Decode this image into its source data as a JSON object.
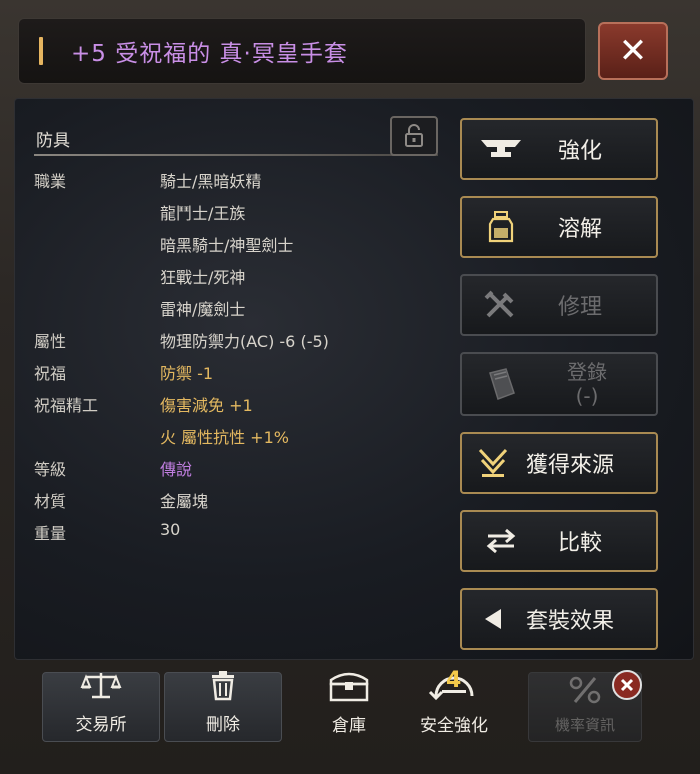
{
  "title": "+5 受祝福的 真·冥皇手套",
  "category": "防具",
  "attributes": [
    {
      "key": "職業",
      "value": "騎士/黑暗妖精",
      "style": "normal"
    },
    {
      "key": "",
      "value": "龍鬥士/王族",
      "style": "normal"
    },
    {
      "key": "",
      "value": "暗黑騎士/神聖劍士",
      "style": "normal"
    },
    {
      "key": "",
      "value": "狂戰士/死神",
      "style": "normal"
    },
    {
      "key": "",
      "value": "雷神/魔劍士",
      "style": "normal"
    },
    {
      "key": "屬性",
      "value": "物理防禦力(AC) -6 (-5)",
      "style": "normal"
    },
    {
      "key": "祝福",
      "value": "防禦 -1",
      "style": "gold"
    },
    {
      "key": "祝福精工",
      "value": "傷害減免 +1",
      "style": "gold"
    },
    {
      "key": "",
      "value": "火 屬性抗性 +1%",
      "style": "gold"
    },
    {
      "key": "等級",
      "value": "傳說",
      "style": "purple"
    },
    {
      "key": "材質",
      "value": "金屬塊",
      "style": "normal"
    },
    {
      "key": "重量",
      "value": "30",
      "style": "normal"
    }
  ],
  "side_buttons": [
    {
      "label": "強化",
      "icon": "anvil-icon",
      "enabled": true
    },
    {
      "label": "溶解",
      "icon": "potion-icon",
      "enabled": true
    },
    {
      "label": "修理",
      "icon": "tools-icon",
      "enabled": false
    },
    {
      "label": "登錄\n(-)",
      "icon": "book-icon",
      "enabled": false
    },
    {
      "label": "獲得來源",
      "icon": "source-icon",
      "enabled": true
    },
    {
      "label": "比較",
      "icon": "swap-icon",
      "enabled": true
    },
    {
      "label": "套裝效果",
      "icon": "triangle-left-icon",
      "enabled": true
    }
  ],
  "bottom_buttons": [
    {
      "label": "交易所",
      "icon": "scale-icon"
    },
    {
      "label": "刪除",
      "icon": "trash-icon"
    },
    {
      "label": "倉庫",
      "icon": "chest-icon"
    },
    {
      "label": "安全強化",
      "icon": "safe-enhance-icon",
      "badge": "4"
    },
    {
      "label": "機率資訊",
      "icon": "percent-icon"
    }
  ],
  "close_label": "✕",
  "colors": {
    "accent_gold": "#a98a52",
    "title": "#c98fe6",
    "legend": "#c07ee0",
    "blessing": "#e3b860"
  }
}
